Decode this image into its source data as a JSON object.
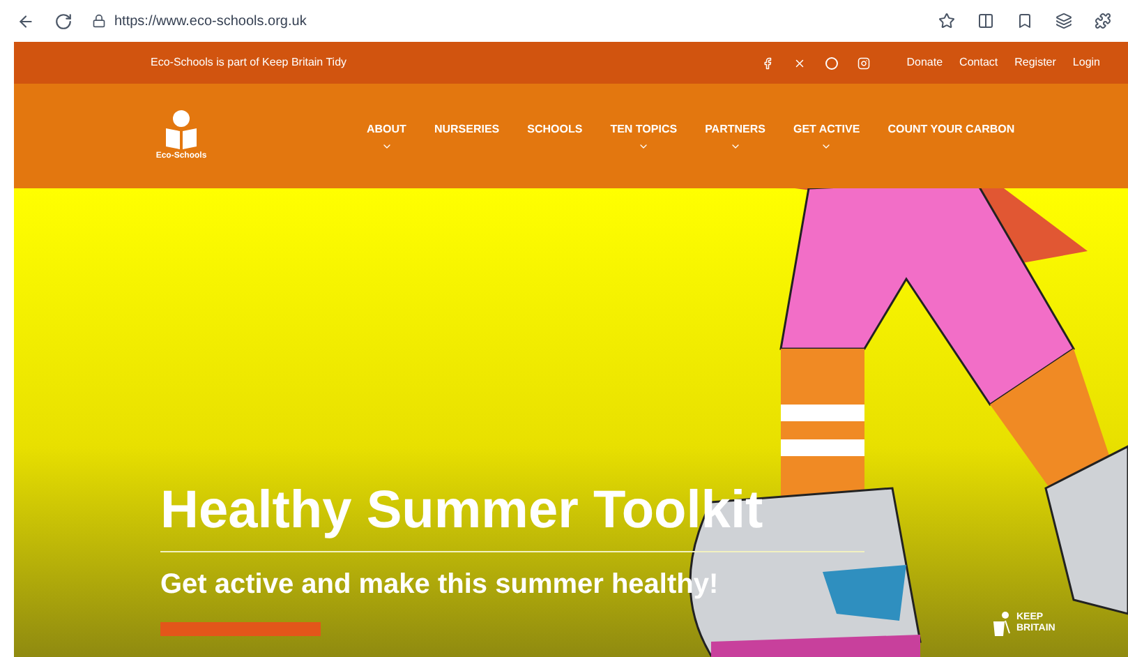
{
  "browser": {
    "url": "https://www.eco-schools.org.uk"
  },
  "top_bar": {
    "tagline": "Eco-Schools is part of Keep Britain Tidy",
    "links": [
      "Donate",
      "Contact",
      "Register",
      "Login"
    ]
  },
  "nav": {
    "logo_text": "Eco-Schools",
    "items": [
      {
        "label": "ABOUT",
        "dropdown": true
      },
      {
        "label": "NURSERIES",
        "dropdown": false
      },
      {
        "label": "SCHOOLS",
        "dropdown": false
      },
      {
        "label": "TEN TOPICS",
        "dropdown": true
      },
      {
        "label": "PARTNERS",
        "dropdown": true
      },
      {
        "label": "GET ACTIVE",
        "dropdown": true
      },
      {
        "label": "COUNT YOUR CARBON",
        "dropdown": false
      }
    ]
  },
  "hero": {
    "title": "Healthy Summer Toolkit",
    "subtitle": "Get active and make this summer healthy!",
    "partner_logo": "KEEP BRITAIN"
  }
}
